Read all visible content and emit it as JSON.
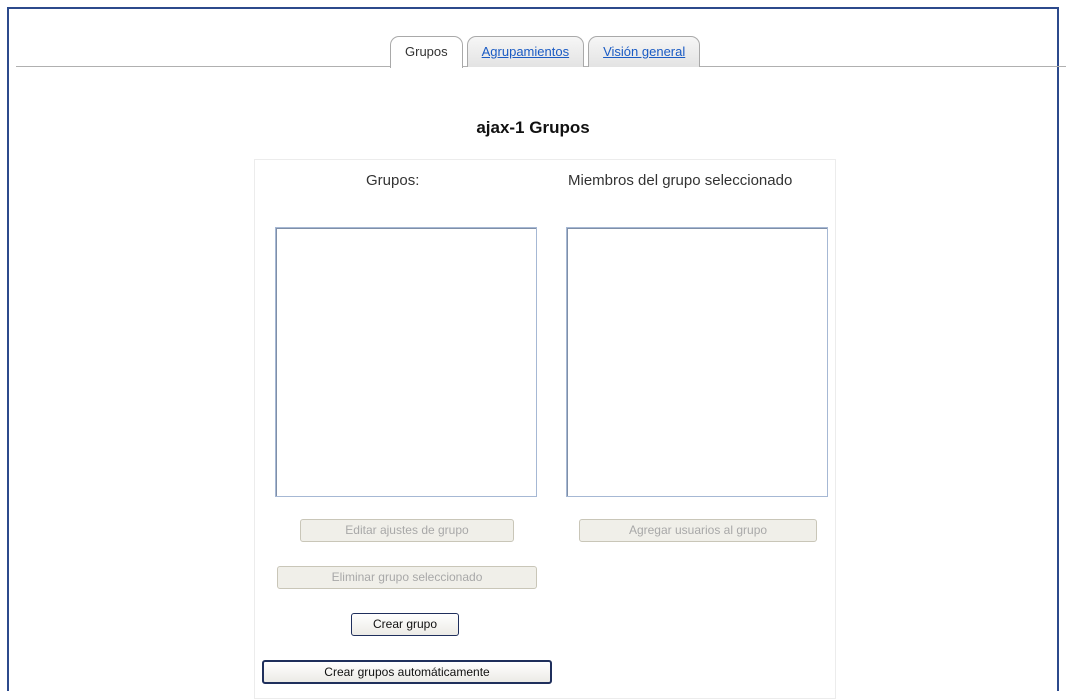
{
  "tabs": [
    {
      "label": "Grupos",
      "active": true
    },
    {
      "label": "Agrupamientos",
      "active": false
    },
    {
      "label": "Visión general",
      "active": false
    }
  ],
  "page_title": "ajax-1 Grupos",
  "groups_column": {
    "label": "Grupos:",
    "items": []
  },
  "members_column": {
    "label": "Miembros del grupo seleccionado",
    "items": []
  },
  "buttons": {
    "edit_group": {
      "label": "Editar ajustes de grupo",
      "enabled": false
    },
    "add_users": {
      "label": "Agregar usuarios al grupo",
      "enabled": false
    },
    "delete_group": {
      "label": "Eliminar grupo seleccionado",
      "enabled": false
    },
    "create_group": {
      "label": "Crear grupo",
      "enabled": true
    },
    "auto_create": {
      "label": "Crear grupos automáticamente",
      "enabled": true
    }
  },
  "colors": {
    "frame_border": "#2c4a8c",
    "link": "#1a5bc4",
    "listbox_border": "#a6b8d4"
  }
}
